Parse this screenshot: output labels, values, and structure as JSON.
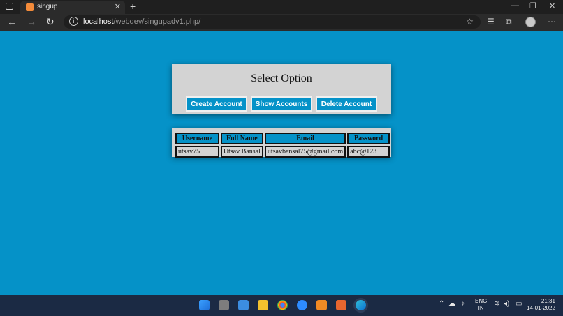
{
  "browser": {
    "tab_title": "singup",
    "tab_close": "✕",
    "new_tab": "+",
    "url_host": "localhost",
    "url_path": "/webdev/singupadv1.php/",
    "back_glyph": "←",
    "forward_glyph": "→",
    "reload_glyph": "↻",
    "info_glyph": "i",
    "win_minimize": "—",
    "win_restore": "❐",
    "win_close": "✕"
  },
  "page": {
    "title": "Select Option",
    "buttons": {
      "create": "Create Account",
      "show": "Show Accounts",
      "delete": "Delete Account"
    },
    "table": {
      "headers": [
        "Username",
        "Full Name",
        "Email",
        "Password"
      ],
      "rows": [
        [
          "utsav75",
          "Utsav Bansal",
          "utsavbansal75@gmail.com",
          "abc@123"
        ]
      ]
    }
  },
  "taskbar": {
    "lang_line1": "ENG",
    "lang_line2": "IN",
    "time": "21:31",
    "date": "14-01-2022"
  },
  "colors": {
    "page_bg": "#0592c8",
    "panel_bg": "#d3d3d3",
    "button_bg": "#0592c8",
    "taskbar_bg": "#1b2a44"
  }
}
